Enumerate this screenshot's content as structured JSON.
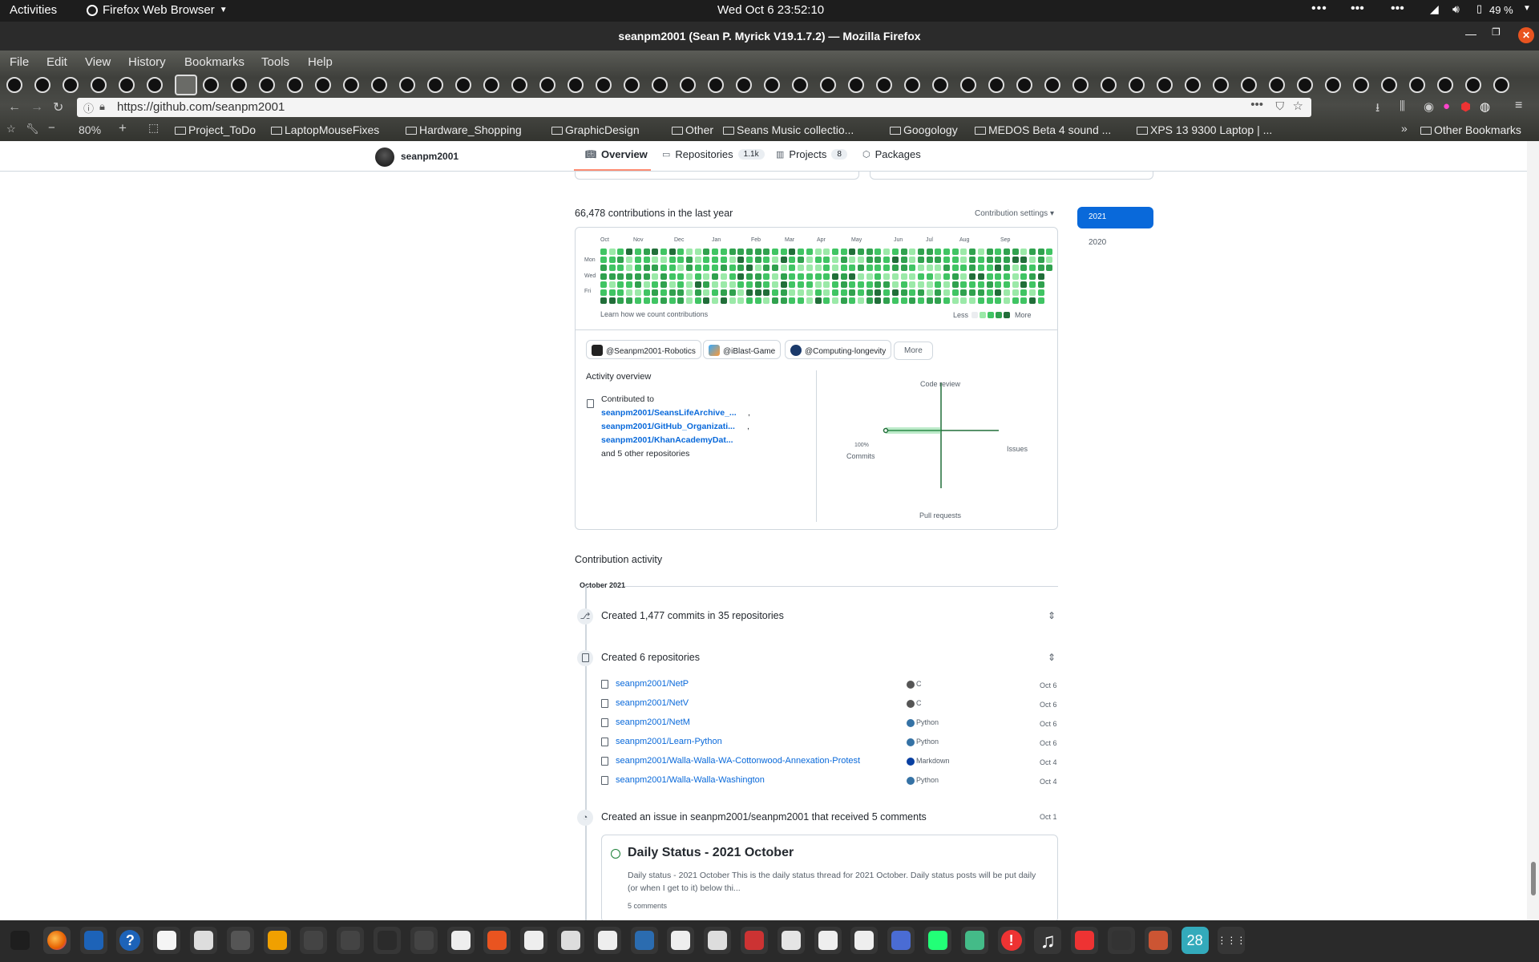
{
  "system": {
    "activities": "Activities",
    "app_name": "Firefox Web Browser",
    "clock": "Wed Oct 6  23:52:10",
    "battery": "49 %"
  },
  "window": {
    "title": "seanpm2001 (Sean P. Myrick V19.1.7.2) — Mozilla Firefox"
  },
  "menu": [
    "File",
    "Edit",
    "View",
    "History",
    "Bookmarks",
    "Tools",
    "Help"
  ],
  "url": "https://github.com/seanpm2001",
  "zoom": "80%",
  "bookmarks": [
    "Project_ToDo",
    "LaptopMouseFixes",
    "Hardware_Shopping",
    "GraphicDesign",
    "Other",
    "Seans Music collectio...",
    "Googology",
    "MEDOS Beta 4 sound ...",
    "XPS 13 9300 Laptop | ...",
    "Other Bookmarks"
  ],
  "profile": {
    "username": "seanpm2001"
  },
  "nav": [
    {
      "label": "Overview",
      "count": ""
    },
    {
      "label": "Repositories",
      "count": "1.1k"
    },
    {
      "label": "Projects",
      "count": "8"
    },
    {
      "label": "Packages",
      "count": ""
    }
  ],
  "contributions": {
    "summary": "66,478 contributions in the last year",
    "settings_label": "Contribution settings",
    "months": [
      "Oct",
      "Nov",
      "Dec",
      "Jan",
      "Feb",
      "Mar",
      "Apr",
      "May",
      "Jun",
      "Jul",
      "Aug",
      "Sep"
    ],
    "days": [
      "Mon",
      "Wed",
      "Fri"
    ],
    "learn_link": "Learn how we count contributions",
    "legend_less": "Less",
    "legend_more": "More",
    "years": [
      "2021",
      "2020"
    ]
  },
  "orgs": [
    "@Seanpm2001-Robotics",
    "@iBlast-Game",
    "@Computing-longevity"
  ],
  "orgs_more": "More",
  "activity_overview": {
    "title": "Activity overview",
    "contributed_to": "Contributed to",
    "repos": [
      "seanpm2001/SeansLifeArchive_...",
      "seanpm2001/GitHub_Organizati...",
      "seanpm2001/KhanAcademyDat..."
    ],
    "others": "and 5 other repositories",
    "axes": {
      "top": "Code review",
      "right": "Issues",
      "bottom": "Pull requests",
      "left_pct": "100%",
      "left": "Commits"
    }
  },
  "contribution_activity": {
    "title": "Contribution activity",
    "period": "October 2021",
    "commits_summary": "Created 1,477 commits in 35 repositories",
    "repos_summary": "Created 6 repositories",
    "created_repos": [
      {
        "name": "seanpm2001/NetP",
        "lang": "C",
        "color": "#555555",
        "date": "Oct 6"
      },
      {
        "name": "seanpm2001/NetV",
        "lang": "C",
        "color": "#555555",
        "date": "Oct 6"
      },
      {
        "name": "seanpm2001/NetM",
        "lang": "Python",
        "color": "#3572A5",
        "date": "Oct 6"
      },
      {
        "name": "seanpm2001/Learn-Python",
        "lang": "Python",
        "color": "#3572A5",
        "date": "Oct 6"
      },
      {
        "name": "seanpm2001/Walla-Walla-WA-Cottonwood-Annexation-Protest",
        "lang": "Markdown",
        "color": "#083fa1",
        "date": "Oct 4"
      },
      {
        "name": "seanpm2001/Walla-Walla-Washington",
        "lang": "Python",
        "color": "#3572A5",
        "date": "Oct 4"
      }
    ],
    "issue_summary": "Created an issue in seanpm2001/seanpm2001 that received 5 comments",
    "issue_date": "Oct 1",
    "issue_title": "Daily Status - 2021 October",
    "issue_body": "Daily status - 2021 October This is the daily status thread for 2021 October. Daily status posts will be put daily (or when I get to it) below thi...",
    "issue_comments": "5 comments"
  },
  "dock_badge": "28",
  "colors": {
    "accent": "#0969da",
    "green_levels": [
      "#ebedf0",
      "#9be9a8",
      "#40c463",
      "#30a14e",
      "#216e39"
    ]
  }
}
